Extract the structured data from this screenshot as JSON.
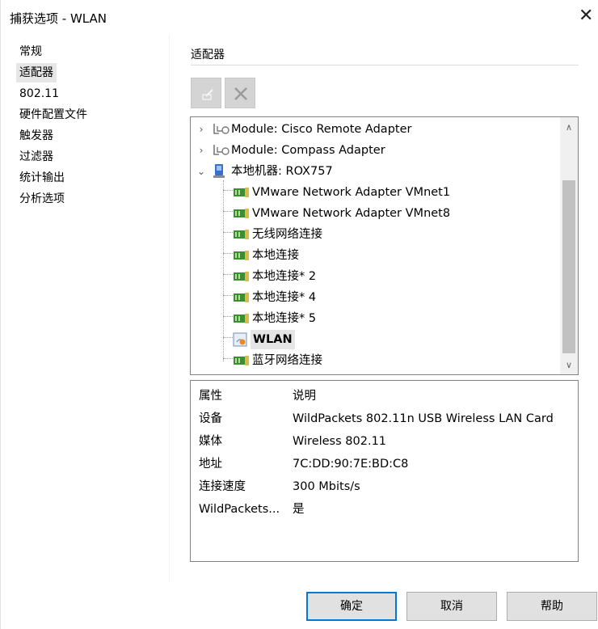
{
  "window": {
    "title": "捕获选项 - WLAN",
    "close_glyph": "✕"
  },
  "nav": {
    "items": [
      {
        "label": "常规",
        "selected": false
      },
      {
        "label": "适配器",
        "selected": true
      },
      {
        "label": "802.11",
        "selected": false
      },
      {
        "label": "硬件配置文件",
        "selected": false
      },
      {
        "label": "触发器",
        "selected": false
      },
      {
        "label": "过滤器",
        "selected": false
      },
      {
        "label": "统计输出",
        "selected": false
      },
      {
        "label": "分析选项",
        "selected": false
      }
    ]
  },
  "section": {
    "title": "适配器"
  },
  "toolbar": {
    "edit_icon": "edit-icon",
    "delete_icon": "delete-icon",
    "delete_glyph": "✕"
  },
  "tree": {
    "expand_collapsed": "›",
    "expand_expanded": "⌄",
    "modules": [
      {
        "label": "Module: Cisco Remote Adapter",
        "icon": "module-icon"
      },
      {
        "label": "Module: Compass Adapter",
        "icon": "module-icon"
      }
    ],
    "machine": {
      "label": "本地机器: ROX757",
      "icon": "computer-icon"
    },
    "adapters": [
      {
        "label": "VMware Network Adapter VMnet1",
        "icon": "network-card-icon"
      },
      {
        "label": "VMware Network Adapter VMnet8",
        "icon": "network-card-icon"
      },
      {
        "label": "无线网络连接",
        "icon": "network-card-icon"
      },
      {
        "label": "本地连接",
        "icon": "network-card-icon"
      },
      {
        "label": "本地连接* 2",
        "icon": "network-card-icon"
      },
      {
        "label": "本地连接* 4",
        "icon": "network-card-icon"
      },
      {
        "label": "本地连接* 5",
        "icon": "network-card-icon"
      },
      {
        "label": "WLAN",
        "icon": "wireless-adapter-icon",
        "selected": true
      },
      {
        "label": "蓝牙网络连接",
        "icon": "network-card-icon"
      }
    ],
    "scroll_up_glyph": "∧",
    "scroll_down_glyph": "∨"
  },
  "properties": {
    "header": {
      "key": "属性",
      "value": "说明"
    },
    "rows": [
      {
        "key": "设备",
        "value": "WildPackets 802.11n USB Wireless LAN Card"
      },
      {
        "key": "媒体",
        "value": "Wireless 802.11"
      },
      {
        "key": "地址",
        "value": "7C:DD:90:7E:BD:C8"
      },
      {
        "key": "连接速度",
        "value": "300 Mbits/s"
      },
      {
        "key": "WildPackets...",
        "value": "是"
      }
    ]
  },
  "buttons": {
    "ok": "确定",
    "cancel": "取消",
    "help": "帮助"
  },
  "colors": {
    "default_button_border": "#0078d7",
    "selection_bg": "#e5e5e5",
    "nic_green": "#3a8f2e"
  }
}
